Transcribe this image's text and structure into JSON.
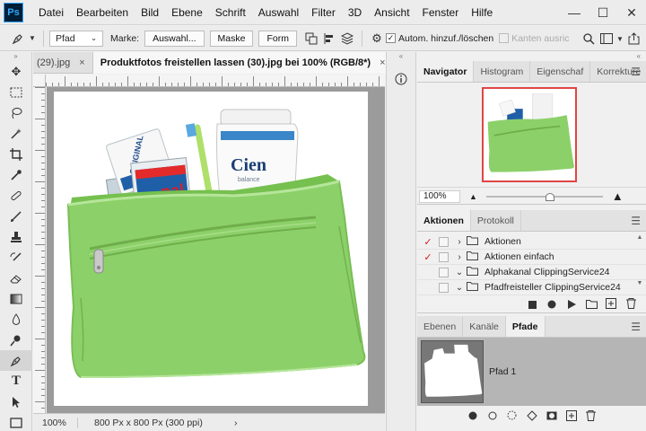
{
  "app": {
    "logo": "Ps"
  },
  "menu": [
    "Datei",
    "Bearbeiten",
    "Bild",
    "Ebene",
    "Schrift",
    "Auswahl",
    "Filter",
    "3D",
    "Ansicht",
    "Fenster",
    "Hilfe"
  ],
  "window_controls": {
    "minimize": "—",
    "maximize": "☐",
    "close": "✕"
  },
  "options_bar": {
    "tool_mode": "Pfad",
    "marke_label": "Marke:",
    "auswahl_button": "Auswahl...",
    "maske_button": "Maske",
    "form_button": "Form",
    "auto_add_delete_label": "Autom. hinzuf./löschen",
    "auto_add_delete_checked": true,
    "align_edges_label": "Kanten ausric",
    "align_edges_checked": false
  },
  "tabs": [
    {
      "label": "(29).jpg",
      "close": "×",
      "active": false
    },
    {
      "label": "Produktfotos freistellen lassen (30).jpg bei 100% (RGB/8*)",
      "close": "×",
      "active": true
    }
  ],
  "status": {
    "zoom": "100%",
    "info": "800 Px x 800 Px (300 ppi)",
    "more": "›"
  },
  "canvas_image": {
    "bag_color": "#8cd06a",
    "brand_text": "Cien",
    "brand_sub": "balance",
    "tube_text": "ORIGINAL",
    "tube_text2": "nal"
  },
  "navigator": {
    "tabs": [
      "Navigator",
      "Histogram",
      "Eigenschaf",
      "Korrekture"
    ],
    "zoom": "100%",
    "zoom_slider": 0.55,
    "view_frame_color": "#e04545"
  },
  "actions": {
    "tabs": [
      "Aktionen",
      "Protokoll"
    ],
    "items": [
      {
        "checked": true,
        "expanded": false,
        "label": "Aktionen"
      },
      {
        "checked": true,
        "expanded": false,
        "label": "Aktionen einfach"
      },
      {
        "checked": false,
        "expanded": true,
        "label": "Alphakanal ClippingService24"
      },
      {
        "checked": false,
        "expanded": true,
        "label": "Pfadfreisteller ClippingService24"
      }
    ],
    "buttons": [
      "stop",
      "record",
      "play",
      "new-set",
      "new-action",
      "delete"
    ]
  },
  "layers": {
    "tabs": [
      "Ebenen",
      "Kanäle",
      "Pfade"
    ],
    "paths": [
      {
        "label": "Pfad 1"
      }
    ],
    "buttons": [
      "fill",
      "stroke",
      "selection",
      "path-from-selection",
      "mask",
      "new",
      "delete"
    ]
  },
  "colors": {
    "accent_check": "#d01c1c",
    "nav_frame": "#e04545"
  }
}
